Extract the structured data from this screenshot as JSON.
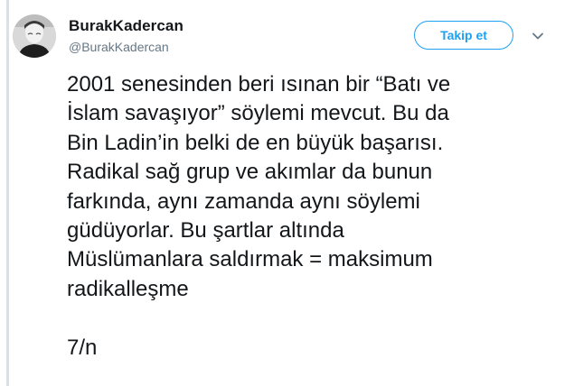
{
  "tweet": {
    "author": {
      "display_name": "BurakKadercan",
      "handle": "@BurakKadercan",
      "avatar_icon": "profile-avatar"
    },
    "follow_label": "Takip et",
    "menu_icon": "chevron-down-icon",
    "text": "2001 senesinden beri ısınan bir “Batı ve\nİslam savaşıyor” söylemi mevcut. Bu da\nBin Ladin’in belki de en büyük başarısı.\nRadikal sağ grup ve akımlar da bunun\nfarkında, aynı zamanda aynı söylemi\ngüdüyorlar. Bu şartlar altında\nMüslümanlara saldırmak = maksimum\nradikalleşme\n\n7/n"
  },
  "colors": {
    "accent": "#1da1f2",
    "text": "#14171a",
    "secondary_text": "#657786",
    "thread_line": "#d7e1e8"
  }
}
